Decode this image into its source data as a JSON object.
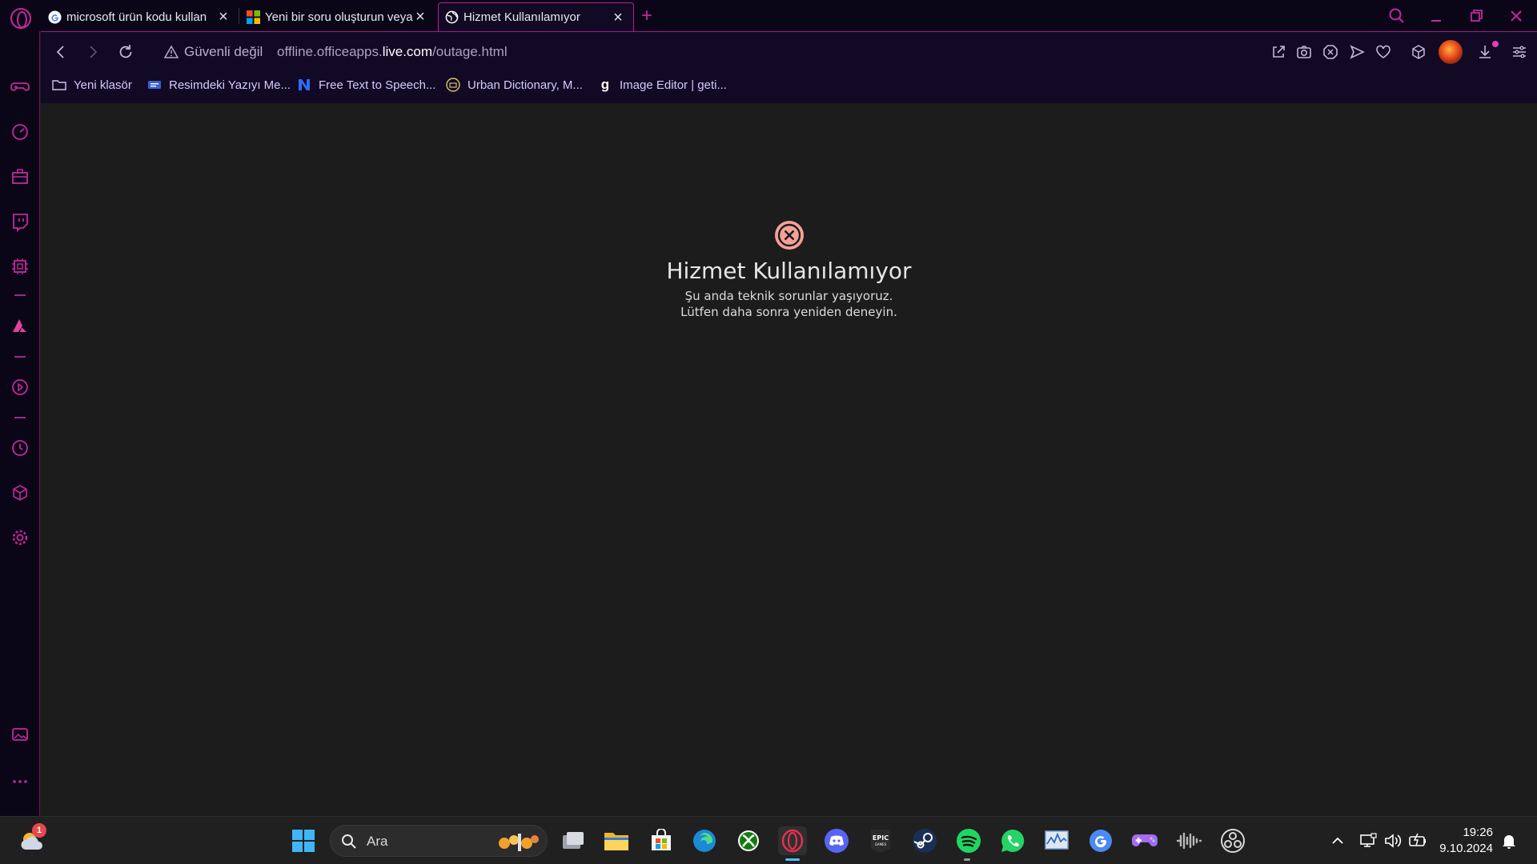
{
  "browser": {
    "tabs": [
      {
        "title": "microsoft ürün kodu kullan",
        "icon": "google-icon"
      },
      {
        "title": "Yeni bir soru oluşturun veya",
        "icon": "microsoft-icon"
      },
      {
        "title": "Hizmet Kullanılamıyor",
        "icon": "globe-icon",
        "active": true
      }
    ],
    "address": {
      "security_label": "Güvenli değil",
      "url_prefix": "offline.officeapps.",
      "url_host": "live.com",
      "url_suffix": "/outage.html"
    },
    "bookmarks": [
      {
        "label": "Yeni klasör",
        "icon": "folder-icon"
      },
      {
        "label": "Resimdeki Yazıyı Me...",
        "icon": "bookmark-favicon-icon"
      },
      {
        "label": "Free Text to Speech...",
        "icon": "n-logo-icon"
      },
      {
        "label": "Urban Dictionary, M...",
        "icon": "urban-dictionary-icon"
      },
      {
        "label": "Image Editor | geti...",
        "icon": "g-logo-icon"
      }
    ],
    "accent_color": "#c02a9a"
  },
  "page": {
    "error_title": "Hizmet Kullanılamıyor",
    "error_line1": "Şu anda teknik sorunlar yaşıyoruz.",
    "error_line2": "Lütfen daha sonra yeniden deneyin.",
    "error_icon_color": "#f4a198"
  },
  "taskbar": {
    "search_placeholder": "Ara",
    "weather_badge": "1",
    "time": "19:26",
    "date": "9.10.2024"
  }
}
